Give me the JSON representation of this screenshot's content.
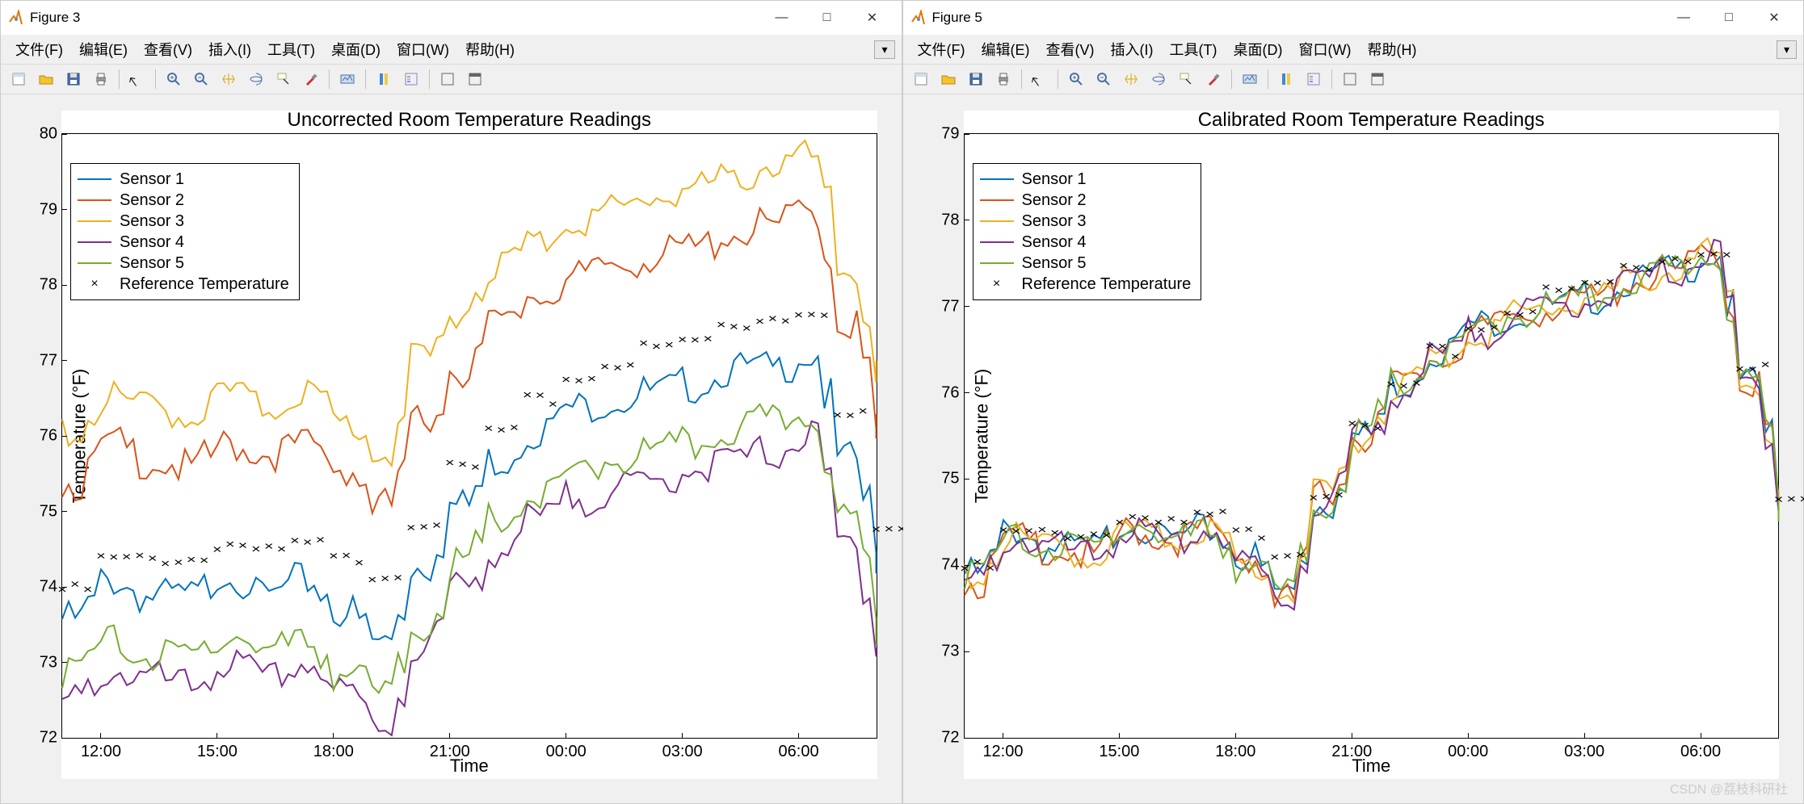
{
  "watermark": "CSDN @荔枝科研社",
  "windows": [
    {
      "title": "Figure 3",
      "menus": [
        "文件(F)",
        "编辑(E)",
        "查看(V)",
        "插入(I)",
        "工具(T)",
        "桌面(D)",
        "窗口(W)",
        "帮助(H)"
      ],
      "chart": {
        "title": "Uncorrected Room Temperature Readings",
        "ylabel": "Temperature (°F)",
        "xlabel": "Time",
        "ylim": [
          72,
          80
        ],
        "yticks": [
          72,
          73,
          74,
          75,
          76,
          77,
          78,
          79,
          80
        ],
        "xticks": [
          "12:00",
          "15:00",
          "18:00",
          "21:00",
          "00:00",
          "03:00",
          "06:00"
        ],
        "legend": [
          {
            "label": "Sensor 1",
            "color": "#0072BD"
          },
          {
            "label": "Sensor 2",
            "color": "#D95319"
          },
          {
            "label": "Sensor 3",
            "color": "#EDB120"
          },
          {
            "label": "Sensor 4",
            "color": "#7E2F8E"
          },
          {
            "label": "Sensor 5",
            "color": "#77AC30"
          },
          {
            "label": "Reference Temperature",
            "marker": "×"
          }
        ]
      }
    },
    {
      "title": "Figure 5",
      "menus": [
        "文件(F)",
        "编辑(E)",
        "查看(V)",
        "插入(I)",
        "工具(T)",
        "桌面(D)",
        "窗口(W)",
        "帮助(H)"
      ],
      "chart": {
        "title": "Calibrated Room Temperature Readings",
        "ylabel": "Temperature (°F)",
        "xlabel": "Time",
        "ylim": [
          72,
          79
        ],
        "yticks": [
          72,
          73,
          74,
          75,
          76,
          77,
          78,
          79
        ],
        "legend": [
          {
            "label": "Sensor 1",
            "color": "#0072BD"
          },
          {
            "label": "Sensor 2",
            "color": "#D95319"
          },
          {
            "label": "Sensor 3",
            "color": "#EDB120"
          },
          {
            "label": "Sensor 4",
            "color": "#7E2F8E"
          },
          {
            "label": "Sensor 5",
            "color": "#77AC30"
          },
          {
            "label": "Reference Temperature",
            "marker": "×"
          }
        ],
        "xticks": [
          "12:00",
          "15:00",
          "18:00",
          "21:00",
          "00:00",
          "03:00",
          "06:00"
        ]
      }
    }
  ],
  "chart_data": [
    {
      "type": "line",
      "title": "Uncorrected Room Temperature Readings",
      "xlabel": "Time",
      "ylabel": "Temperature (°F)",
      "ylim": [
        72,
        80
      ],
      "x_hours": [
        11,
        12,
        13,
        14,
        15,
        16,
        17,
        18,
        19,
        20,
        21,
        22,
        23,
        24,
        25,
        26,
        27,
        28,
        29,
        30,
        31,
        32
      ],
      "series": [
        {
          "name": "Sensor 1",
          "color": "#0072BD",
          "values": [
            73.7,
            74.2,
            74.0,
            74.0,
            74.3,
            74.0,
            74.2,
            73.8,
            73.4,
            74.4,
            75.2,
            75.8,
            76.2,
            76.5,
            76.6,
            76.7,
            76.8,
            77.0,
            77.0,
            77.2,
            75.8,
            74.5
          ]
        },
        {
          "name": "Sensor 2",
          "color": "#D95319",
          "values": [
            75.5,
            76.0,
            75.8,
            75.7,
            76.0,
            75.9,
            76.0,
            75.7,
            75.2,
            76.3,
            77.0,
            77.6,
            78.0,
            78.2,
            78.4,
            78.5,
            78.6,
            78.8,
            78.9,
            79.1,
            77.6,
            76.2
          ]
        },
        {
          "name": "Sensor 3",
          "color": "#EDB120",
          "values": [
            76.2,
            76.6,
            76.5,
            76.4,
            76.7,
            76.5,
            76.7,
            76.3,
            75.9,
            77.1,
            77.8,
            78.4,
            78.7,
            79.0,
            79.1,
            79.3,
            79.4,
            79.5,
            79.7,
            79.8,
            78.3,
            76.9
          ]
        },
        {
          "name": "Sensor 4",
          "color": "#7E2F8E",
          "values": [
            72.6,
            73.0,
            72.9,
            72.8,
            73.1,
            72.9,
            73.1,
            72.7,
            72.3,
            73.3,
            74.1,
            74.6,
            75.0,
            75.3,
            75.4,
            75.5,
            75.7,
            75.8,
            75.9,
            76.1,
            74.7,
            73.3
          ]
        },
        {
          "name": "Sensor 5",
          "color": "#77AC30",
          "values": [
            73.0,
            73.4,
            73.2,
            73.2,
            73.5,
            73.3,
            73.4,
            73.0,
            72.7,
            73.6,
            74.4,
            75.0,
            75.3,
            75.6,
            75.8,
            75.9,
            76.0,
            76.2,
            76.3,
            76.4,
            75.0,
            73.6
          ]
        }
      ],
      "reference": {
        "name": "Reference Temperature",
        "marker": "×",
        "values": [
          74.0,
          74.4,
          74.4,
          74.4,
          74.6,
          74.5,
          74.6,
          74.4,
          74.2,
          74.9,
          75.6,
          76.1,
          76.5,
          76.8,
          77.0,
          77.2,
          77.3,
          77.5,
          77.6,
          77.7,
          76.3,
          74.8
        ]
      }
    },
    {
      "type": "line",
      "title": "Calibrated Room Temperature Readings",
      "xlabel": "Time",
      "ylabel": "Temperature (°F)",
      "ylim": [
        72,
        79
      ],
      "x_hours": [
        11,
        12,
        13,
        14,
        15,
        16,
        17,
        18,
        19,
        20,
        21,
        22,
        23,
        24,
        25,
        26,
        27,
        28,
        29,
        30,
        31,
        32
      ],
      "series": [
        {
          "name": "Sensor 1",
          "color": "#0072BD",
          "values": [
            74.0,
            74.5,
            74.3,
            74.3,
            74.6,
            74.4,
            74.5,
            74.2,
            73.8,
            74.8,
            75.6,
            76.2,
            76.6,
            76.9,
            77.0,
            77.1,
            77.2,
            77.4,
            77.5,
            77.7,
            76.2,
            74.8
          ]
        },
        {
          "name": "Sensor 2",
          "color": "#D95319",
          "values": [
            73.9,
            74.4,
            74.3,
            74.2,
            74.5,
            74.4,
            74.5,
            74.2,
            73.7,
            74.9,
            75.6,
            76.2,
            76.5,
            76.8,
            77.0,
            77.1,
            77.2,
            77.4,
            77.5,
            77.7,
            76.2,
            74.8
          ]
        },
        {
          "name": "Sensor 3",
          "color": "#EDB120",
          "values": [
            74.0,
            74.4,
            74.3,
            74.2,
            74.5,
            74.4,
            74.5,
            74.1,
            73.8,
            74.9,
            75.6,
            76.2,
            76.5,
            76.8,
            77.0,
            77.1,
            77.2,
            77.4,
            77.5,
            77.7,
            76.2,
            74.8
          ]
        },
        {
          "name": "Sensor 4",
          "color": "#7E2F8E",
          "values": [
            73.9,
            74.4,
            74.3,
            74.2,
            74.5,
            74.3,
            74.5,
            74.1,
            73.7,
            74.8,
            75.6,
            76.1,
            76.5,
            76.8,
            77.0,
            77.1,
            77.2,
            77.4,
            77.5,
            77.7,
            76.2,
            74.8
          ]
        },
        {
          "name": "Sensor 5",
          "color": "#77AC30",
          "values": [
            74.0,
            74.4,
            74.3,
            74.3,
            74.6,
            74.4,
            74.5,
            74.1,
            73.8,
            74.8,
            75.6,
            76.2,
            76.5,
            76.8,
            77.0,
            77.1,
            77.2,
            77.4,
            77.5,
            77.7,
            76.2,
            74.8
          ]
        }
      ],
      "reference": {
        "name": "Reference Temperature",
        "marker": "×",
        "values": [
          74.0,
          74.4,
          74.4,
          74.4,
          74.6,
          74.5,
          74.6,
          74.4,
          74.2,
          74.9,
          75.6,
          76.1,
          76.5,
          76.8,
          77.0,
          77.2,
          77.3,
          77.5,
          77.6,
          77.7,
          76.3,
          74.8
        ]
      }
    }
  ]
}
